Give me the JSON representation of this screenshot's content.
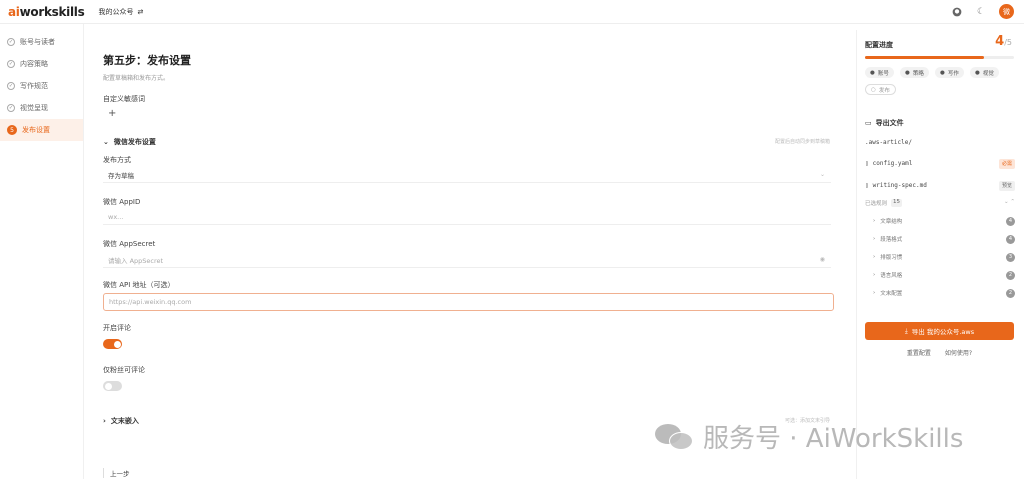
{
  "header": {
    "logo_a": "ai",
    "logo_b": "workskills",
    "account": "我的公众号",
    "avatar_text": "微"
  },
  "sidebar": {
    "items": [
      {
        "label": "账号与读者",
        "active": false
      },
      {
        "label": "内容策略",
        "active": false
      },
      {
        "label": "写作规范",
        "active": false
      },
      {
        "label": "视觉呈现",
        "active": false
      },
      {
        "label": "发布设置",
        "active": true,
        "num": "5"
      }
    ]
  },
  "main": {
    "title": "第五步：发布设置",
    "subtitle": "配置草稿箱和发布方式。",
    "custom_keywords_label": "自定义敏感词",
    "add_symbol": "+",
    "wechat_section": {
      "title": "微信发布设置",
      "hint": "配置后自动同步到草稿箱"
    },
    "publish_mode": {
      "label": "发布方式",
      "value": "存为草稿"
    },
    "appid": {
      "label": "微信 AppID",
      "placeholder": "wx..."
    },
    "appsecret": {
      "label": "微信 AppSecret",
      "placeholder": "请输入 AppSecret"
    },
    "api_url": {
      "label": "微信 API 地址（可选）",
      "placeholder": "https://api.weixin.qq.com"
    },
    "comments": {
      "label": "开启评论",
      "on": true
    },
    "fans_only": {
      "label": "仅粉丝可评论",
      "on": false
    },
    "text_section": {
      "title": "文末嵌入",
      "hint": "可选：添加文末引导"
    },
    "prev_button": "上一步"
  },
  "progress": {
    "title": "配置进度",
    "current": "4",
    "total": "/5",
    "fraction": 0.8,
    "steps": [
      {
        "label": "账号",
        "done": true
      },
      {
        "label": "策略",
        "done": true
      },
      {
        "label": "写作",
        "done": true
      },
      {
        "label": "视觉",
        "done": true
      },
      {
        "label": "发布",
        "done": false
      }
    ]
  },
  "export": {
    "title": "导出文件",
    "folder": ".aws-article/",
    "files": [
      {
        "name": "config.yaml",
        "badge": "必需",
        "badge_type": "warn"
      },
      {
        "name": "writing-spec.md",
        "badge": "预览",
        "badge_type": "plain"
      }
    ],
    "tree_label": "已选规则",
    "tree_count": "15",
    "tree": [
      {
        "label": "文章结构",
        "count": "4"
      },
      {
        "label": "段落格式",
        "count": "4"
      },
      {
        "label": "排版习惯",
        "count": "3"
      },
      {
        "label": "语言风格",
        "count": "2"
      },
      {
        "label": "文末配置",
        "count": "2"
      }
    ],
    "button": "导出 我的公众号.aws",
    "link_reset": "重置配置",
    "link_help": "如何使用?"
  },
  "watermark": {
    "text": "服务号 · AiWorkSkills"
  },
  "icons": {
    "github": "github-icon",
    "theme": "moon-icon",
    "swap": "swap-icon",
    "doc": "file-icon",
    "folder": "folder-icon"
  },
  "colors": {
    "accent": "#e8671b"
  }
}
